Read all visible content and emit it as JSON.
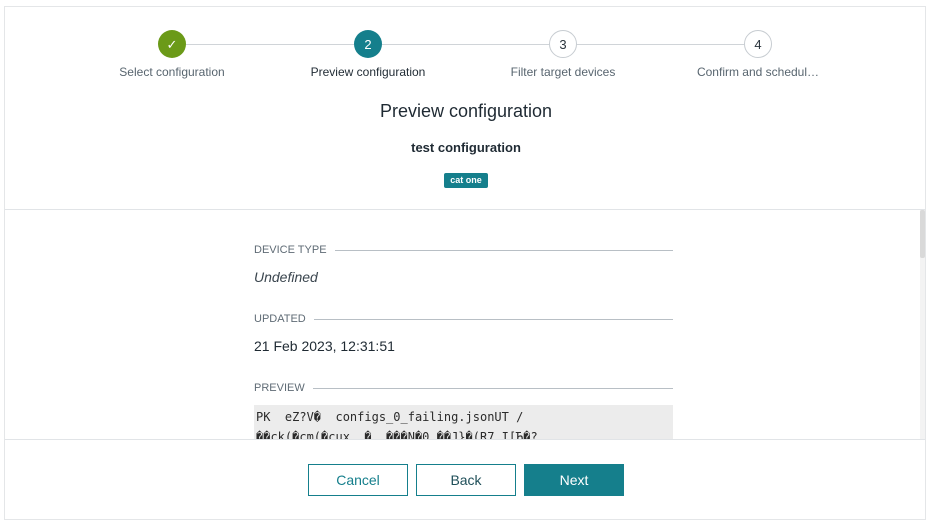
{
  "stepper": {
    "steps": [
      {
        "label": "Select configuration",
        "number": "1",
        "state": "done"
      },
      {
        "label": "Preview configuration",
        "number": "2",
        "state": "active"
      },
      {
        "label": "Filter target devices",
        "number": "3",
        "state": "todo"
      },
      {
        "label": "Confirm and schedul…",
        "number": "4",
        "state": "todo"
      }
    ],
    "done_glyph": "✓"
  },
  "header": {
    "title": "Preview configuration",
    "config_name": "test configuration",
    "tag": "cat one"
  },
  "details": {
    "device_type_label": "DEVICE TYPE",
    "device_type_value": "Undefined",
    "updated_label": "UPDATED",
    "updated_value": "21 Feb 2023, 12:31:51",
    "preview_label": "PREVIEW",
    "preview_lines": [
      "PK  eZ?V�  configs_0_failing.jsonUT /",
      "��ck(�cm(�cux  �  ���N�0 ��J}�(R7 I[Ђ�?"
    ]
  },
  "footer": {
    "cancel_label": "Cancel",
    "back_label": "Back",
    "next_label": "Next"
  },
  "colors": {
    "accent": "#157f8c",
    "done": "#6b9a18"
  }
}
